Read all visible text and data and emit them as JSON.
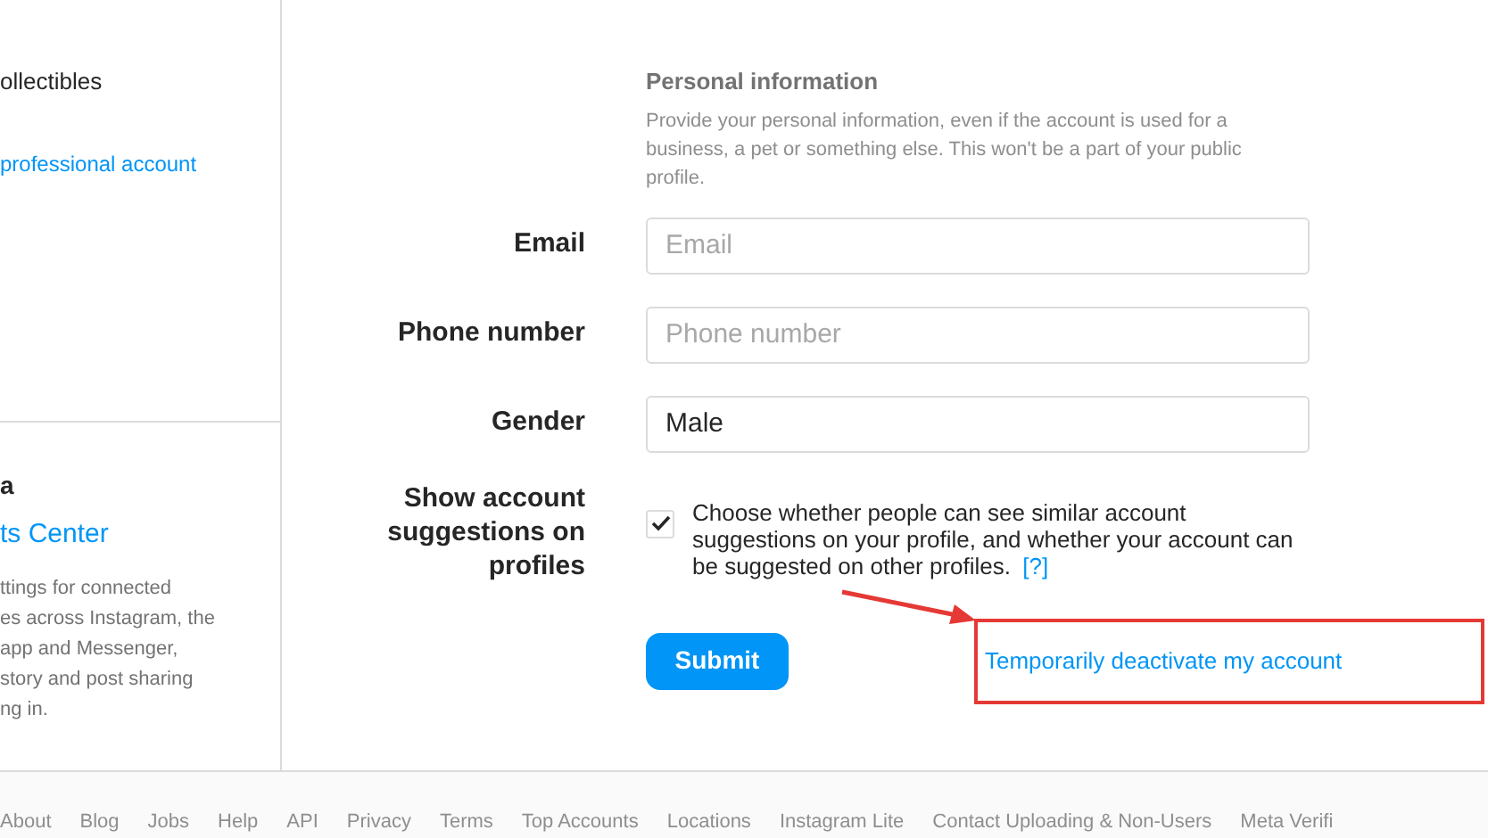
{
  "sidebar": {
    "items": [
      {
        "label": "ollectibles",
        "kind": "plain"
      },
      {
        "label": "professional account",
        "kind": "link"
      }
    ],
    "accounts_center": {
      "heading": "a",
      "link": "ts Center",
      "description": "ttings for connected\nes across Instagram, the\napp and Messenger,\nstory and post sharing\nng in."
    }
  },
  "personal_information": {
    "title": "Personal information",
    "description": "Provide your personal information, even if the account is used for a business, a pet or something else. This won't be a part of your public profile."
  },
  "fields": [
    {
      "label": "Email",
      "placeholder": "Email"
    },
    {
      "label": "Phone number",
      "placeholder": "Phone number"
    },
    {
      "label": "Gender",
      "value": "Male"
    }
  ],
  "suggestions": {
    "label": "Show account suggestions on profiles",
    "checked": true,
    "text": "Choose whether people can see similar account suggestions on your profile, and whether your account can be suggested on other profiles.",
    "help": "[?]"
  },
  "submit": "Submit",
  "deactivate_link": "Temporarily deactivate my account",
  "footer": [
    "About",
    "Blog",
    "Jobs",
    "Help",
    "API",
    "Privacy",
    "Terms",
    "Top Accounts",
    "Locations",
    "Instagram Lite",
    "Contact Uploading & Non-Users",
    "Meta Verifi"
  ]
}
